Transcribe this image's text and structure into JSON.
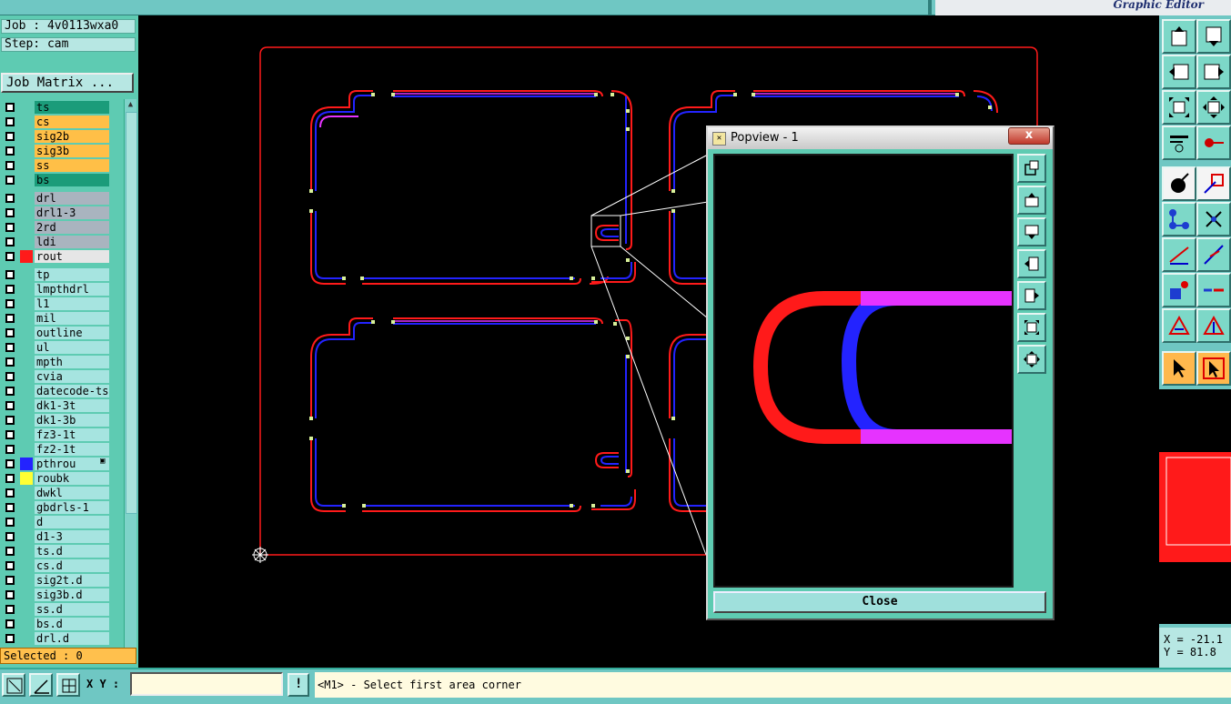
{
  "window": {
    "title_text": "Graphic Editor"
  },
  "left_panel": {
    "job": "Job : 4v0113wxa0",
    "step": "Step: cam",
    "matrix_button": "Job Matrix ...",
    "selected": "Selected : 0",
    "layers": [
      {
        "name": "ts",
        "color": "#1b9c7a",
        "swatch": ""
      },
      {
        "name": "cs",
        "color": "#ffbf47",
        "swatch": ""
      },
      {
        "name": "sig2b",
        "color": "#ffbf47",
        "swatch": ""
      },
      {
        "name": "sig3b",
        "color": "#ffbf47",
        "swatch": ""
      },
      {
        "name": "ss",
        "color": "#ffbf47",
        "swatch": ""
      },
      {
        "name": "bs",
        "color": "#1b9c7a",
        "swatch": ""
      },
      {
        "name": "drl",
        "color": "#a9b4bf",
        "swatch": ""
      },
      {
        "name": "drl1-3",
        "color": "#a9b4bf",
        "swatch": ""
      },
      {
        "name": "2rd",
        "color": "#a9b4bf",
        "swatch": ""
      },
      {
        "name": "ldi",
        "color": "#a9b4bf",
        "swatch": ""
      },
      {
        "name": "rout",
        "color": "#e6e6e6",
        "swatch": "#ff1a1a"
      },
      {
        "name": "tp",
        "color": "#a6e4e0",
        "swatch": ""
      },
      {
        "name": "lmpthdrl",
        "color": "#a6e4e0",
        "swatch": ""
      },
      {
        "name": "l1",
        "color": "#a6e4e0",
        "swatch": ""
      },
      {
        "name": "mil",
        "color": "#a6e4e0",
        "swatch": ""
      },
      {
        "name": "outline",
        "color": "#a6e4e0",
        "swatch": ""
      },
      {
        "name": "ul",
        "color": "#a6e4e0",
        "swatch": ""
      },
      {
        "name": "mpth",
        "color": "#a6e4e0",
        "swatch": ""
      },
      {
        "name": "cvia",
        "color": "#a6e4e0",
        "swatch": ""
      },
      {
        "name": "datecode-ts",
        "color": "#a6e4e0",
        "swatch": ""
      },
      {
        "name": "dk1-3t",
        "color": "#a6e4e0",
        "swatch": ""
      },
      {
        "name": "dk1-3b",
        "color": "#a6e4e0",
        "swatch": ""
      },
      {
        "name": "fz3-1t",
        "color": "#a6e4e0",
        "swatch": ""
      },
      {
        "name": "fz2-1t",
        "color": "#a6e4e0",
        "swatch": ""
      },
      {
        "name": "pthrou",
        "color": "#a6e4e0",
        "swatch": "#2323ff"
      },
      {
        "name": "roubk",
        "color": "#a6e4e0",
        "swatch": "#ffff33"
      },
      {
        "name": "dwkl",
        "color": "#a6e4e0",
        "swatch": ""
      },
      {
        "name": "gbdrls-1",
        "color": "#a6e4e0",
        "swatch": ""
      },
      {
        "name": "d",
        "color": "#a6e4e0",
        "swatch": ""
      },
      {
        "name": "d1-3",
        "color": "#a6e4e0",
        "swatch": ""
      },
      {
        "name": "ts.d",
        "color": "#a6e4e0",
        "swatch": ""
      },
      {
        "name": "cs.d",
        "color": "#a6e4e0",
        "swatch": ""
      },
      {
        "name": "sig2t.d",
        "color": "#a6e4e0",
        "swatch": ""
      },
      {
        "name": "sig3b.d",
        "color": "#a6e4e0",
        "swatch": ""
      },
      {
        "name": "ss.d",
        "color": "#a6e4e0",
        "swatch": ""
      },
      {
        "name": "bs.d",
        "color": "#a6e4e0",
        "swatch": ""
      },
      {
        "name": "drl.d",
        "color": "#a6e4e0",
        "swatch": ""
      }
    ]
  },
  "popview": {
    "title": "Popview - 1",
    "close_x": "x",
    "close_button": "Close"
  },
  "coords": {
    "x": "X = -21.1",
    "y": "Y = 81.8"
  },
  "bottom": {
    "xy_label": "X Y :",
    "xy_value": "",
    "alert": "!",
    "status": "<M1> - Select first area corner"
  },
  "colors": {
    "rout": "#ff1a1a",
    "pthrou": "#2323ff",
    "overlap": "#e633ff",
    "pad": "#d8f09a"
  }
}
